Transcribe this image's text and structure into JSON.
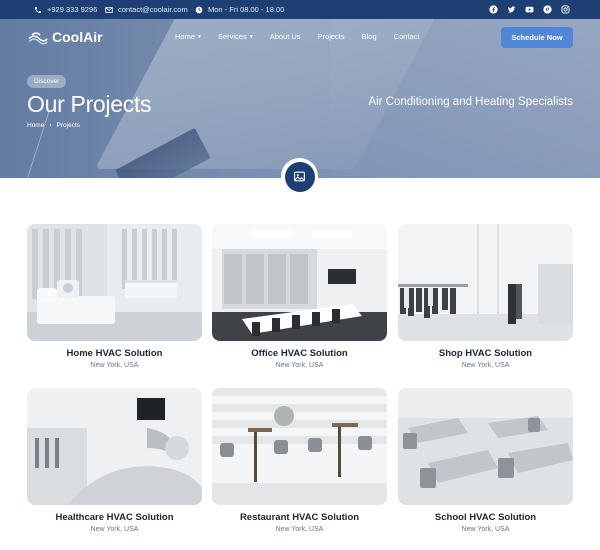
{
  "topbar": {
    "phone": "+929 333 9296",
    "email": "contact@coolair.com",
    "hours": "Mon - Fri 08.00 - 18.00",
    "social_icons": [
      "facebook-icon",
      "twitter-icon",
      "youtube-icon",
      "pinterest-icon",
      "instagram-icon"
    ]
  },
  "brand": {
    "name": "CoolAir"
  },
  "nav": {
    "items": [
      {
        "label": "Home",
        "has_caret": true
      },
      {
        "label": "Services",
        "has_caret": true
      },
      {
        "label": "About Us",
        "has_caret": false
      },
      {
        "label": "Projects",
        "has_caret": false
      },
      {
        "label": "Blog",
        "has_caret": false
      },
      {
        "label": "Contact",
        "has_caret": false
      }
    ],
    "cta_label": "Schedule Now"
  },
  "hero": {
    "badge": "Discover",
    "title": "Our Projects",
    "tagline": "Air Conditioning and Heating Specialists",
    "breadcrumb": [
      "Home",
      "Projects"
    ],
    "icon": "image-icon"
  },
  "projects": [
    {
      "name": "Home HVAC Solution",
      "location": "New York, USA"
    },
    {
      "name": "Office HVAC Solution",
      "location": "New York, USA"
    },
    {
      "name": "Shop HVAC Solution",
      "location": "New York, USA"
    },
    {
      "name": "Healthcare HVAC Solution",
      "location": "New York, USA"
    },
    {
      "name": "Restaurant HVAC Solution",
      "location": "New York, USA"
    },
    {
      "name": "School HVAC Solution",
      "location": "New York, USA"
    }
  ],
  "colors": {
    "primary": "#1d3f73",
    "accent": "#4f86d6"
  }
}
